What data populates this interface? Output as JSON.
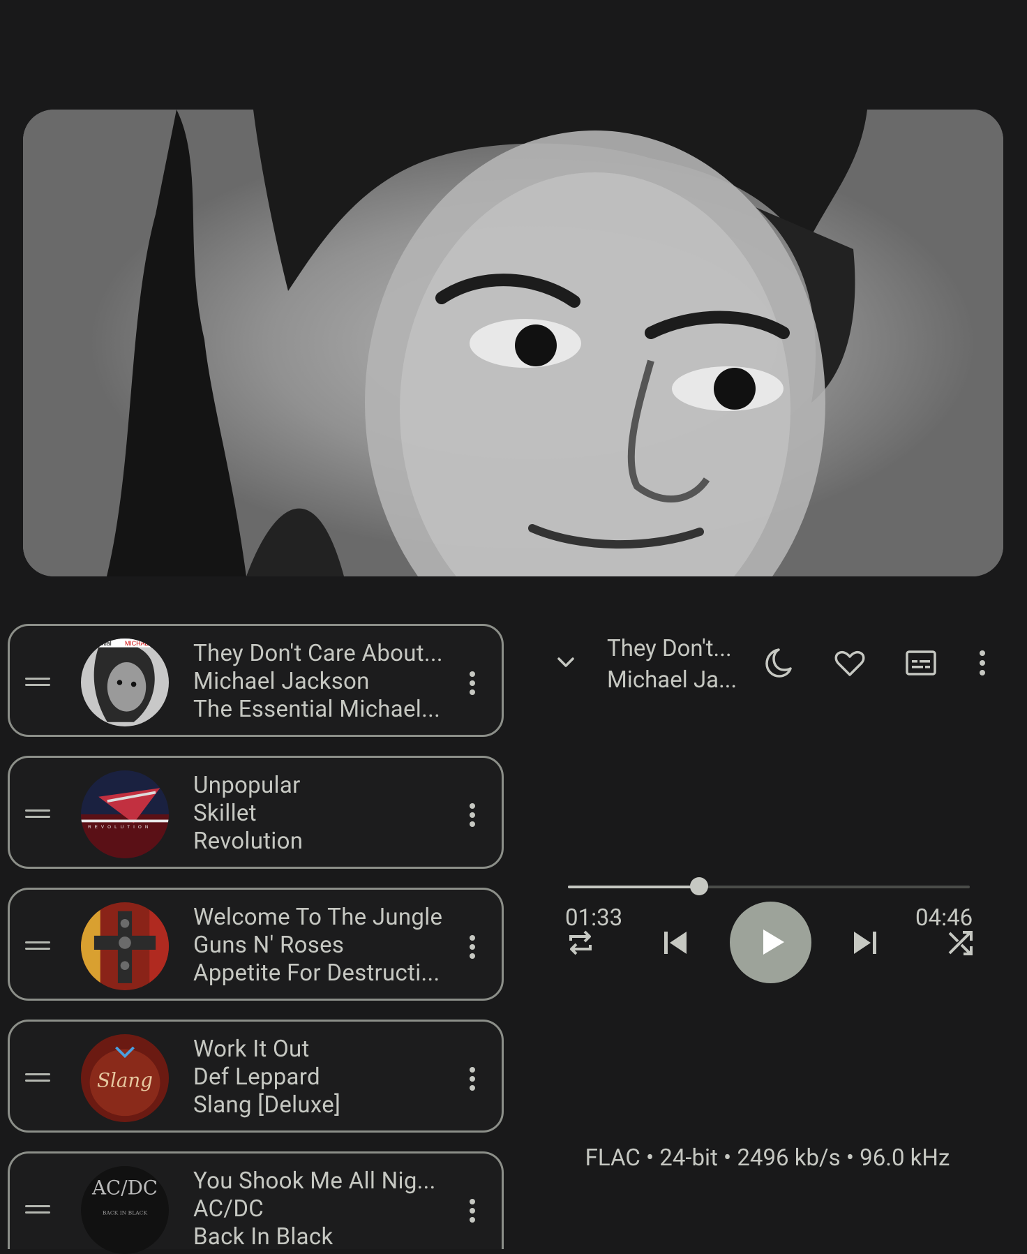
{
  "artwork": {
    "description_icon": "album-artwork"
  },
  "queue": [
    {
      "title": "They Don't Care About...",
      "artist": "Michael Jackson",
      "album": "The Essential Michael...",
      "cover_icon": "cover-essential-michael-jackson"
    },
    {
      "title": "Unpopular",
      "artist": "Skillet",
      "album": "Revolution",
      "cover_icon": "cover-revolution"
    },
    {
      "title": "Welcome To The Jungle",
      "artist": "Guns N' Roses",
      "album": "Appetite For Destructi...",
      "cover_icon": "cover-appetite-for-destruction"
    },
    {
      "title": "Work It Out",
      "artist": "Def Leppard",
      "album": "Slang [Deluxe]",
      "cover_icon": "cover-slang"
    },
    {
      "title": "You Shook Me All Nig...",
      "artist": "AC/DC",
      "album": "Back In Black",
      "cover_icon": "cover-back-in-black"
    }
  ],
  "now_playing": {
    "title": "They Don't...",
    "artist": "Michael Ja...",
    "elapsed": "01:33",
    "duration": "04:46",
    "progress": 0.326,
    "format": "FLAC • 24-bit • 2496 kb/s • 96.0 kHz"
  },
  "icons": [
    "chevron-down-icon",
    "sleep-timer-icon",
    "favorite-icon",
    "lyrics-icon",
    "more-vert-icon",
    "repeat-icon",
    "skip-previous-icon",
    "play-icon",
    "skip-next-icon",
    "shuffle-icon",
    "drag-handle-icon"
  ],
  "colors": {
    "background": "#19191a",
    "text": "#c6c8c2",
    "outline": "#8c8f89",
    "play_button": "#9da39a"
  }
}
